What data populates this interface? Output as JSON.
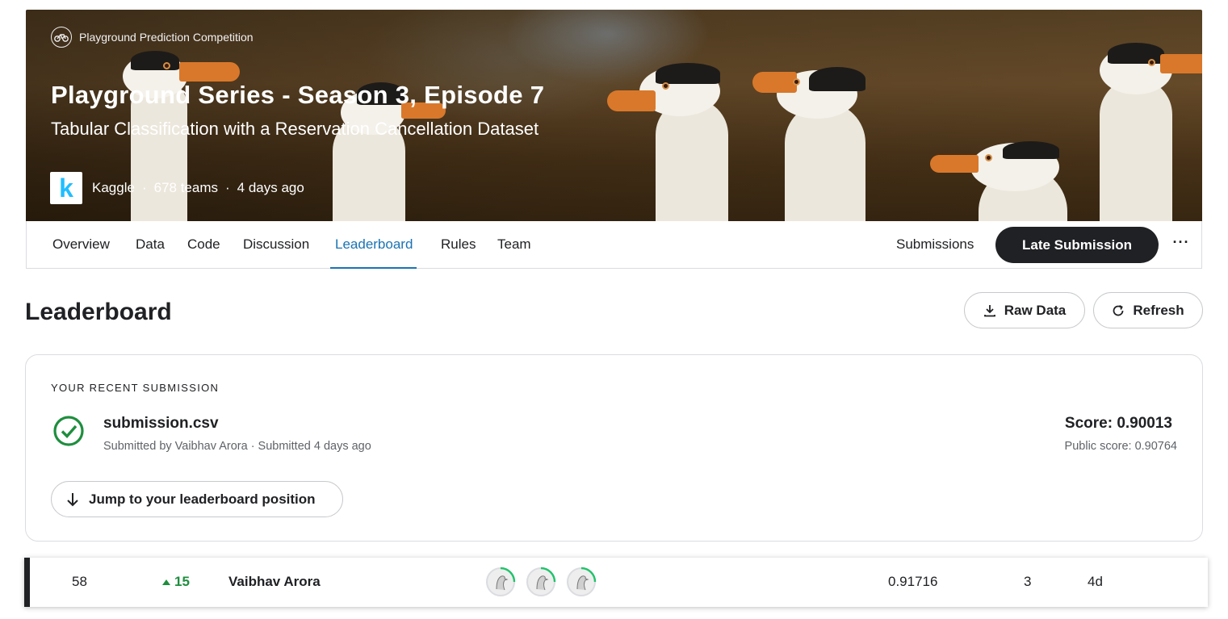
{
  "banner": {
    "competition_type": "Playground Prediction Competition",
    "title": "Playground Series - Season 3, Episode 7",
    "subtitle": "Tabular Classification with a Reservation Cancellation Dataset",
    "logo_letter": "k",
    "host": "Kaggle",
    "teams": "678 teams",
    "time_ago": "4 days ago",
    "separator": "·"
  },
  "tabs": [
    {
      "label": "Overview"
    },
    {
      "label": "Data"
    },
    {
      "label": "Code"
    },
    {
      "label": "Discussion"
    },
    {
      "label": "Leaderboard",
      "active": true
    },
    {
      "label": "Rules"
    },
    {
      "label": "Team"
    }
  ],
  "actions": {
    "submissions": "Submissions",
    "late_submission": "Late Submission",
    "more": "···"
  },
  "leaderboard": {
    "title": "Leaderboard",
    "raw_data": "Raw Data",
    "refresh": "Refresh"
  },
  "recent_submission": {
    "label": "YOUR RECENT SUBMISSION",
    "file_name": "submission.csv",
    "submitted_by": "Submitted by Vaibhav Arora · Submitted 4 days ago",
    "score": "Score: 0.90013",
    "public_score": "Public score: 0.90764",
    "jump_label": "Jump to your leaderboard position"
  },
  "row": {
    "rank": "58",
    "delta": "15",
    "team_name": "Vaibhav Arora",
    "score": "0.91716",
    "entries": "3",
    "last": "4d"
  },
  "colors": {
    "accent": "#1a73b3",
    "success": "#1e8e3e",
    "dark": "#202124"
  }
}
